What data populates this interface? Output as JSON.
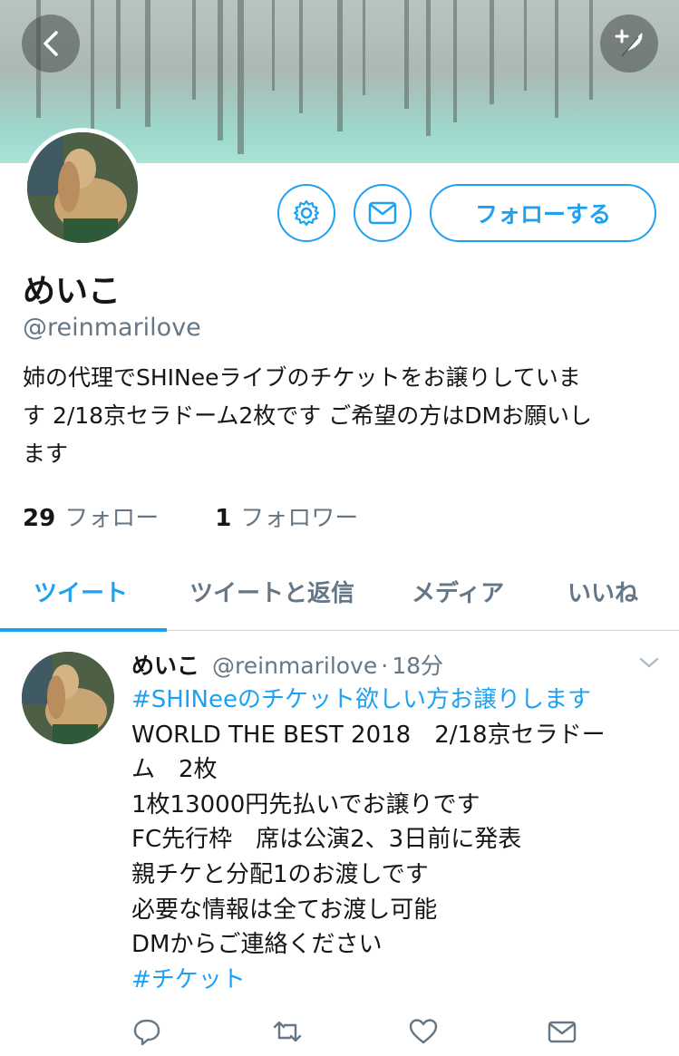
{
  "profile": {
    "name": "めいこ",
    "handle": "@reinmarilove",
    "bio_lines": [
      "姉の代理でSHINeeライブのチケットをお譲りしていま",
      "す 2/18京セラドーム2枚です ご希望の方はDMお願いし",
      "ます"
    ],
    "follow_button": "フォローする",
    "following_count": "29",
    "following_label": "フォロー",
    "followers_count": "1",
    "followers_label": "フォロワー"
  },
  "tabs": [
    {
      "label": "ツイート",
      "active": true
    },
    {
      "label": "ツイートと返信",
      "active": false
    },
    {
      "label": "メディア",
      "active": false
    },
    {
      "label": "いいね",
      "active": false
    }
  ],
  "tweet": {
    "name": "めいこ",
    "handle": "@reinmarilove",
    "separator": "·",
    "time": "18分",
    "lines": [
      "#SHINeeのチケット欲しい方お譲りします",
      "WORLD THE BEST 2018　2/18京セラドー",
      "ム　2枚",
      "1枚13000円先払いでお譲りです",
      "FC先行枠　席は公演2、3日前に発表",
      "親チケと分配1のお渡しです",
      "必要な情報は全てお渡し可能",
      "DMからご連絡ください",
      "#チケット"
    ]
  },
  "icons": {
    "back": "chevron-left-icon",
    "compose": "feather-plus-icon",
    "settings": "gear-icon",
    "message": "envelope-icon",
    "reply": "reply-bubble-icon",
    "retweet": "retweet-icon",
    "like": "heart-icon",
    "dm": "envelope-icon",
    "more": "chevron-down-icon"
  },
  "colors": {
    "accent": "#1da1f2",
    "secondary_text": "#657786",
    "primary_text": "#14171a"
  }
}
